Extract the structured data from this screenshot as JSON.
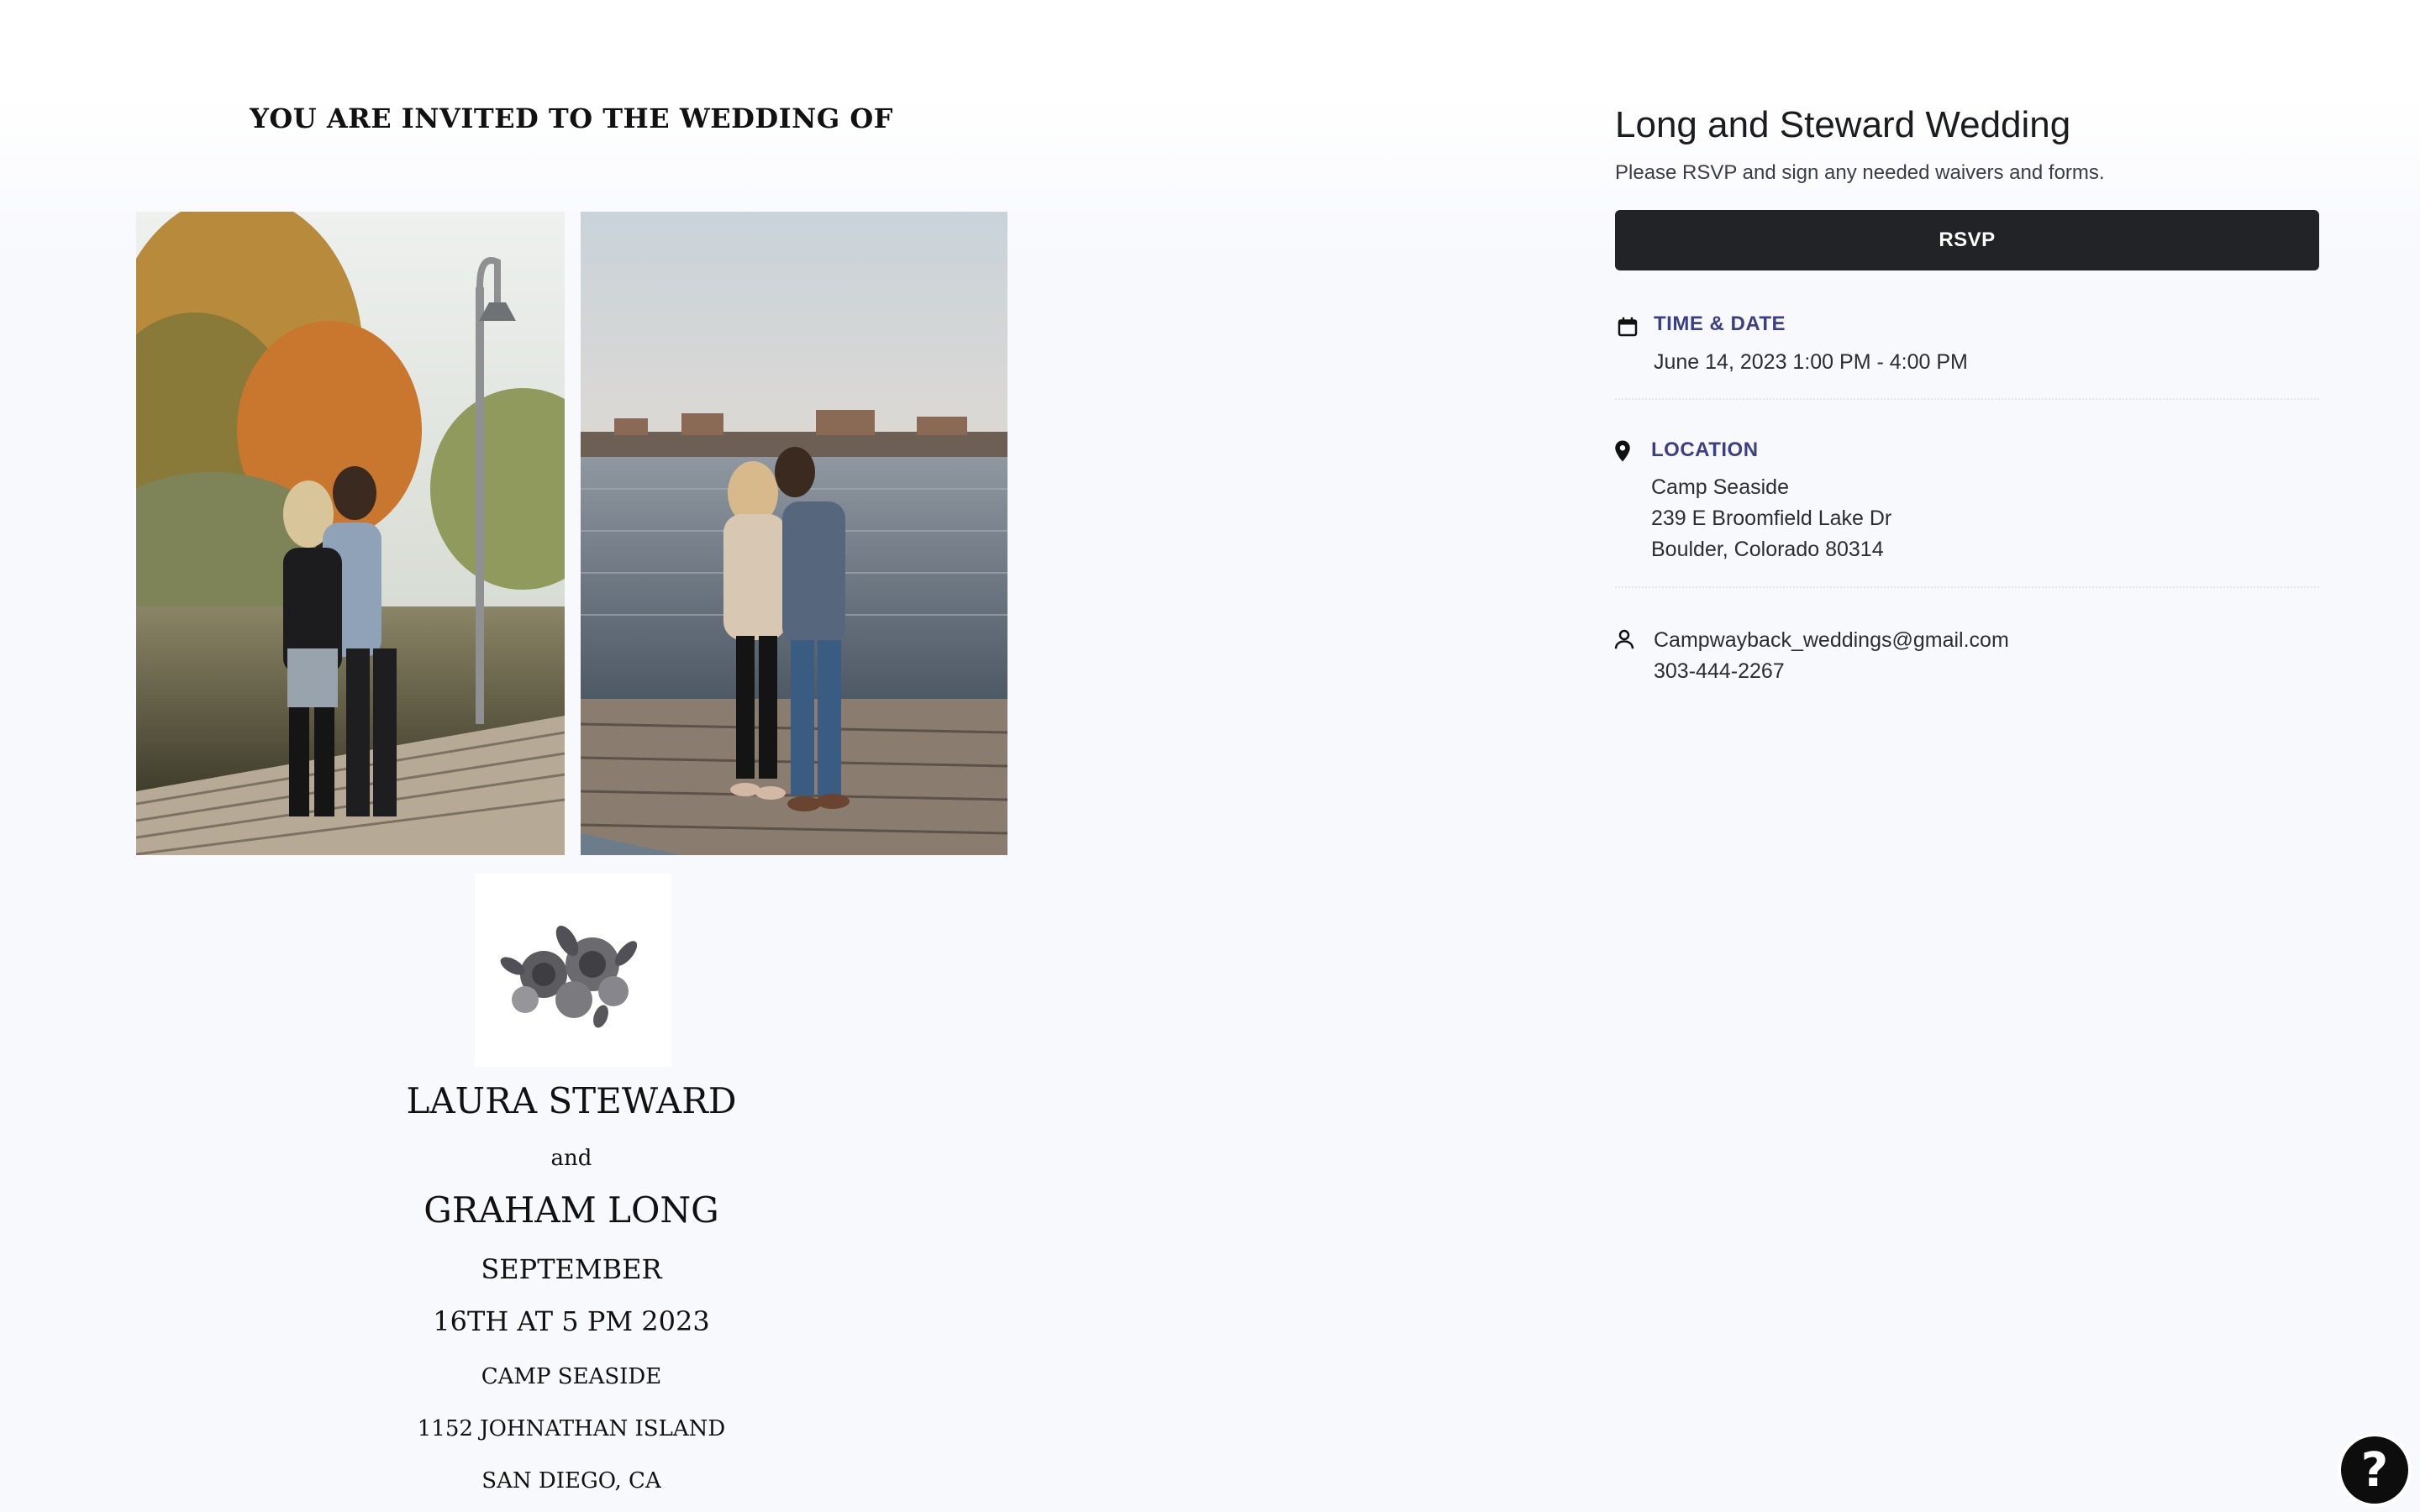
{
  "invitation": {
    "heading": "YOU ARE INVITED TO THE WEDDING OF",
    "bride": "LAURA STEWARD",
    "and": "and",
    "groom": "GRAHAM LONG",
    "month": "SEPTEMBER",
    "datetime": "16TH AT 5 PM 2023",
    "venue": "CAMP SEASIDE",
    "street": "1152 JOHNATHAN ISLAND",
    "city": "SAN DIEGO, CA",
    "photos": [
      "couple-kissing-lamppost-photo",
      "couple-embracing-dock-photo"
    ],
    "ornament_icon": "floral-ornament"
  },
  "event": {
    "title": "Long and Steward Wedding",
    "subtitle": "Please RSVP and sign any needed waivers and forms.",
    "rsvp_label": "RSVP",
    "time_date": {
      "icon": "calendar-icon",
      "heading": "TIME & DATE",
      "value": "June 14, 2023 1:00 PM - 4:00 PM"
    },
    "location": {
      "icon": "map-pin-icon",
      "heading": "LOCATION",
      "line1": "Camp Seaside",
      "line2": "239 E Broomfield Lake Dr",
      "line3": "Boulder, Colorado 80314"
    },
    "contact": {
      "icon": "person-icon",
      "email": "Campwayback_weddings@gmail.com",
      "phone": "303-444-2267"
    }
  },
  "help": {
    "label": "?",
    "icon": "help-icon"
  },
  "colors": {
    "accent_heading": "#3d3f86",
    "button_bg": "#212326",
    "page_bg": "#f8f9fd"
  }
}
